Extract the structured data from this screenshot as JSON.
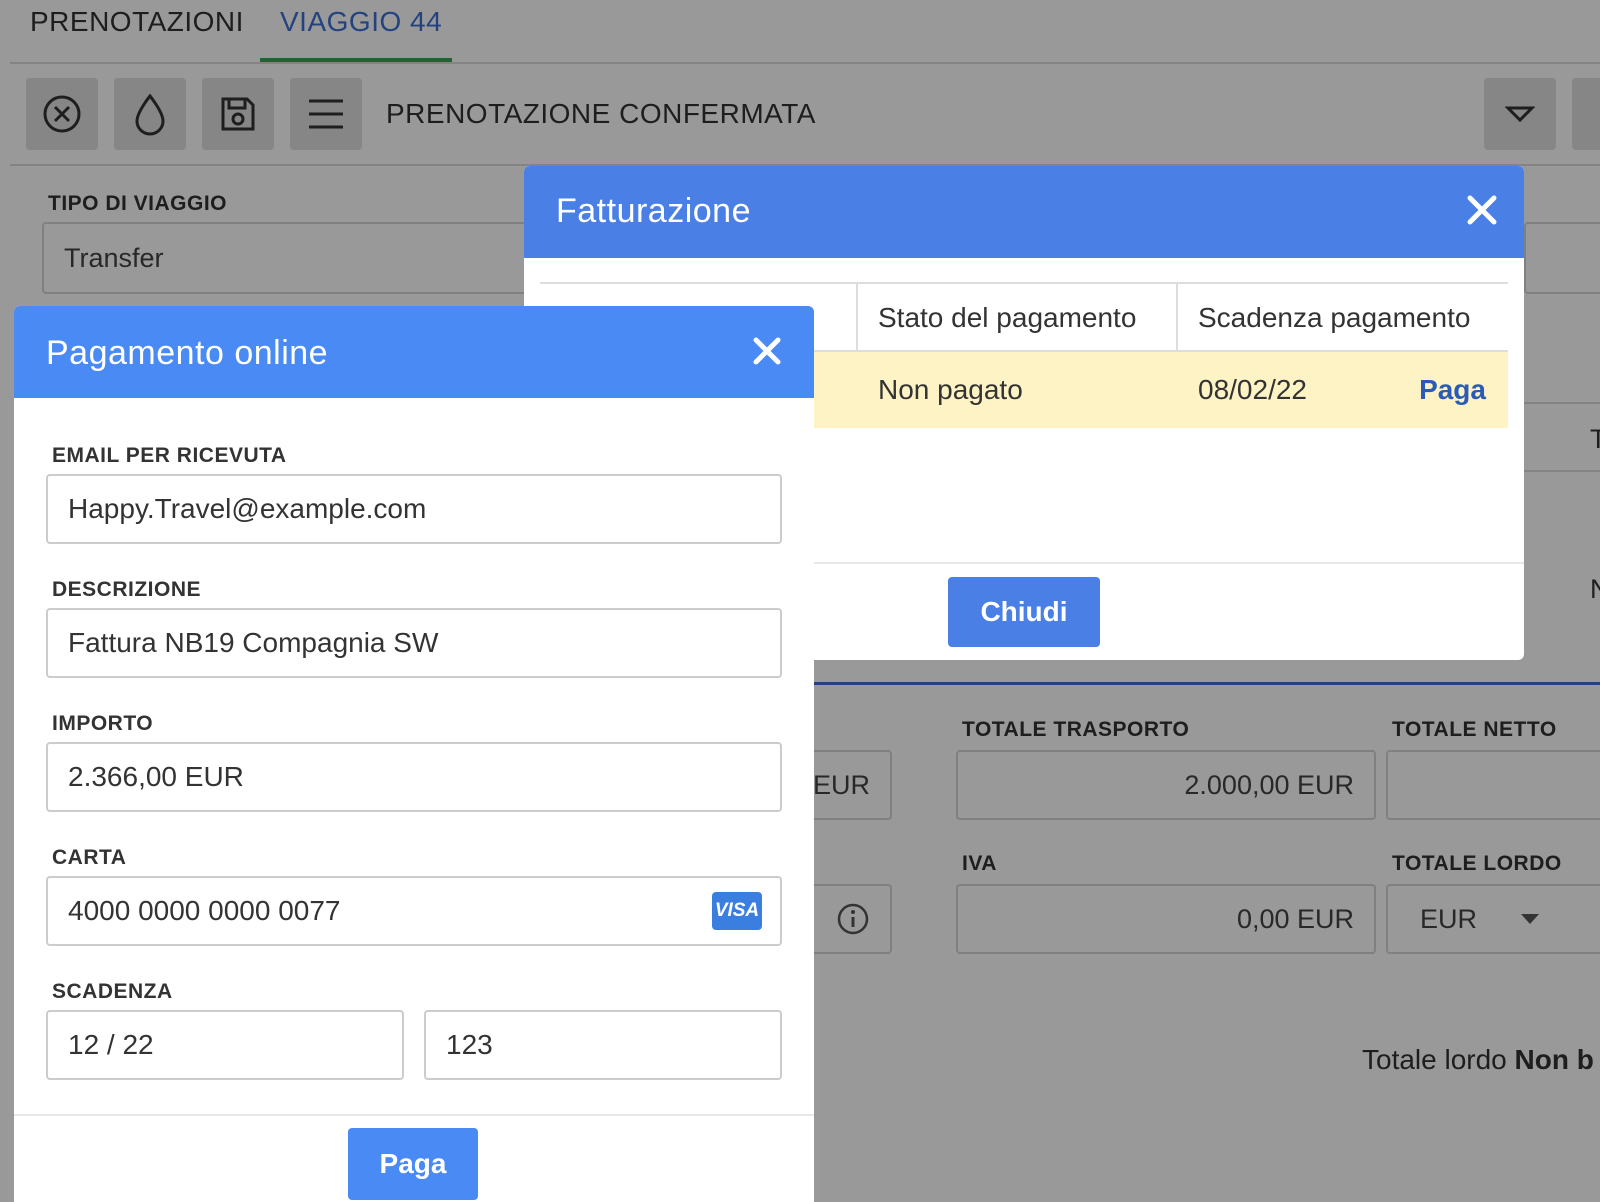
{
  "tabs": [
    {
      "label": "PRENOTAZIONI"
    },
    {
      "label": "VIAGGIO 44"
    }
  ],
  "toolbar": {
    "status_label": "PRENOTAZIONE CONFERMATA"
  },
  "form": {
    "tipo_viaggio_label": "TIPO DI VIAGGIO",
    "tipo_viaggio_value": "Transfer",
    "partial_eur": "EUR",
    "totale_trasporto_label": "TOTALE TRASPORTO",
    "totale_trasporto_value": "2.000,00 EUR",
    "totale_netto_label": "TOTALE NETTO",
    "iva_label": "IVA",
    "iva_value": "0,00 EUR",
    "totale_lordo_label": "TOTALE LORDO",
    "totale_lordo_currency": "EUR",
    "right_cut_1": "T",
    "right_cut_2": "N",
    "bottom_text_prefix": "Totale lordo ",
    "bottom_text_bold": "Non b"
  },
  "fatturazione": {
    "title": "Fatturazione",
    "columns": [
      "Stato del pagamento",
      "Scadenza pagamento"
    ],
    "row": {
      "stato": "Non pagato",
      "scadenza": "08/02/22",
      "action": "Paga"
    },
    "close_button": "Chiudi"
  },
  "pagamento": {
    "title": "Pagamento online",
    "email_label": "EMAIL PER RICEVUTA",
    "email_value": "Happy.Travel@example.com",
    "descrizione_label": "DESCRIZIONE",
    "descrizione_value": "Fattura NB19 Compagnia SW",
    "importo_label": "IMPORTO",
    "importo_value": "2.366,00 EUR",
    "carta_label": "CARTA",
    "carta_value": "4000 0000 0000 0077",
    "card_brand": "VISA",
    "scadenza_label": "SCADENZA",
    "scadenza_value": "12 / 22",
    "cvc_value": "123",
    "pay_button": "Paga"
  },
  "colors": {
    "header_blue": "#4a80e6",
    "pay_dialog_blue": "#4a8af4",
    "active_tab": "#3b6fd4",
    "tab_underline": "#3aa655",
    "unpaid_row": "#fdf3c4"
  }
}
